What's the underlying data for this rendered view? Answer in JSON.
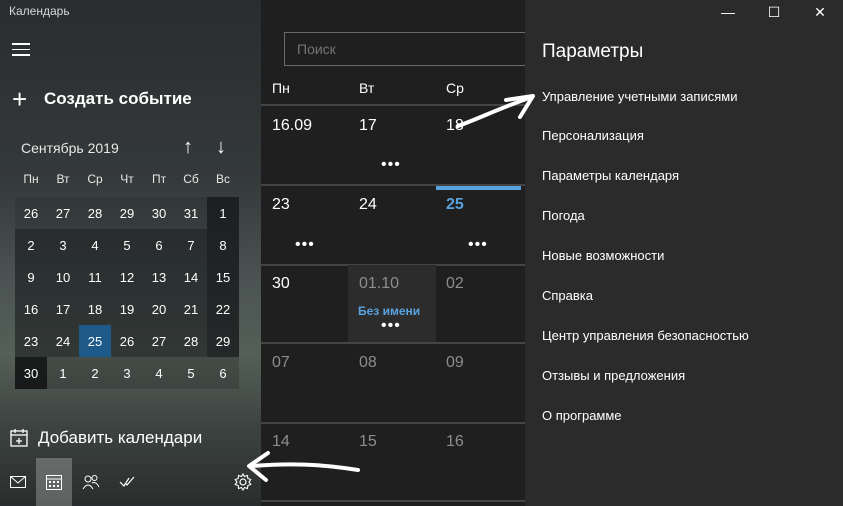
{
  "app": {
    "title": "Календарь"
  },
  "sidebar": {
    "new_event_label": "Создать событие",
    "month_label": "Сентябрь 2019",
    "weekdays": [
      "Пн",
      "Вт",
      "Ср",
      "Чт",
      "Пт",
      "Сб",
      "Вс"
    ],
    "days": [
      [
        "26",
        "27",
        "28",
        "29",
        "30",
        "31",
        "1"
      ],
      [
        "2",
        "3",
        "4",
        "5",
        "6",
        "7",
        "8"
      ],
      [
        "9",
        "10",
        "11",
        "12",
        "13",
        "14",
        "15"
      ],
      [
        "16",
        "17",
        "18",
        "19",
        "20",
        "21",
        "22"
      ],
      [
        "23",
        "24",
        "25",
        "26",
        "27",
        "28",
        "29"
      ],
      [
        "30",
        "1",
        "2",
        "3",
        "4",
        "5",
        "6"
      ]
    ],
    "today": "25",
    "add_calendars_label": "Добавить календари"
  },
  "main": {
    "search_placeholder": "Поиск",
    "day_headers": [
      "Пн",
      "Вт",
      "Ср"
    ],
    "weeks": [
      [
        "16.09",
        "17",
        "18"
      ],
      [
        "23",
        "24",
        "25"
      ],
      [
        "30",
        "01.10",
        "02"
      ],
      [
        "07",
        "08",
        "09"
      ],
      [
        "14",
        "15",
        "16"
      ]
    ],
    "event_title": "Без имени",
    "more_indicator": "•••"
  },
  "settings_panel": {
    "title": "Параметры",
    "items": [
      "Управление учетными записями",
      "Персонализация",
      "Параметры календаря",
      "Погода",
      "Новые возможности",
      "Справка",
      "Центр управления безопасностью",
      "Отзывы и предложения",
      "О программе"
    ]
  },
  "window_controls": {
    "minimize": "—",
    "maximize": "☐",
    "close": "✕"
  },
  "colors": {
    "accent": "#5aa2dd",
    "today_bg": "#1d5a8a",
    "panel_bg": "#2b2b2b",
    "main_bg": "#1f1f1f"
  }
}
